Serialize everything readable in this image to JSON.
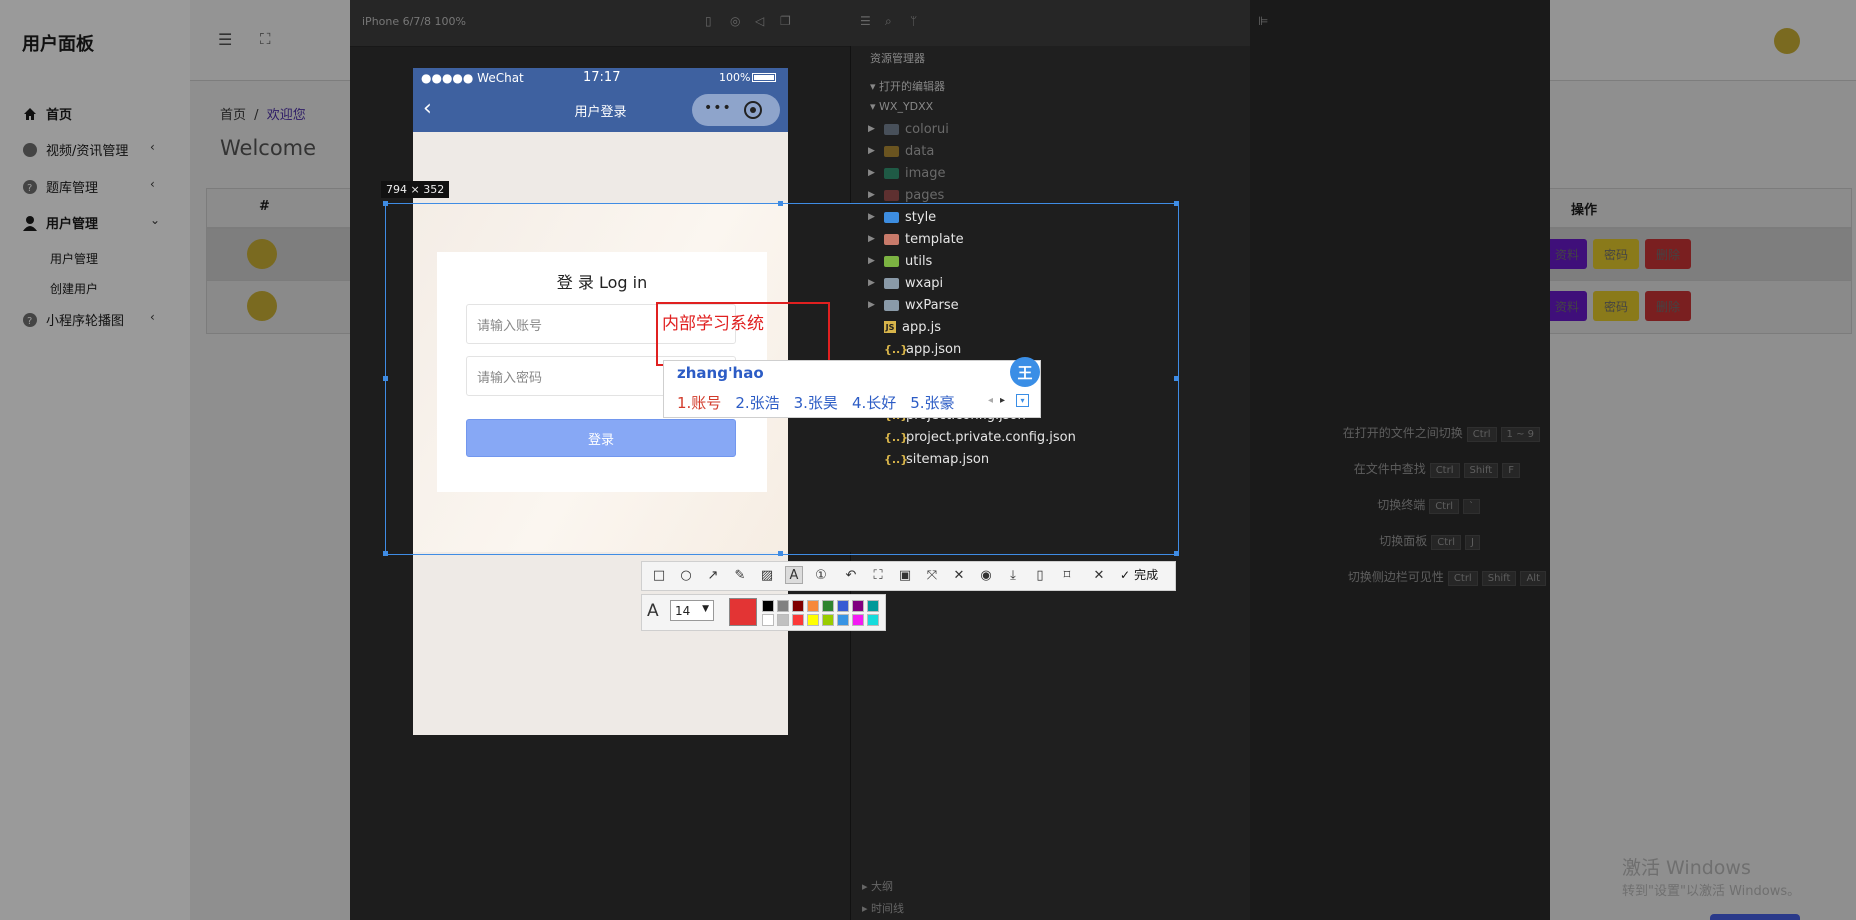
{
  "admin": {
    "title": "用户面板",
    "nav": [
      {
        "label": "首页",
        "icon": "home-icon"
      },
      {
        "label": "视频/资讯管理",
        "icon": "globe-icon"
      },
      {
        "label": "题库管理",
        "icon": "question-icon"
      },
      {
        "label": "用户管理",
        "icon": "user-icon"
      },
      {
        "label": "小程序轮播图",
        "icon": "question-icon"
      }
    ],
    "sub_items": [
      "用户管理",
      "创建用户"
    ],
    "breadcrumb": {
      "home": "首页",
      "separator": "/",
      "current": "欢迎您"
    },
    "welcome": "Welcome",
    "table": {
      "col_index": "#",
      "col_ops": "操作",
      "row_buttons": [
        "资料",
        "密码",
        "删除"
      ]
    }
  },
  "devtools": {
    "device": "iPhone 6/7/8 100%",
    "explorer": {
      "title": "资源管理器",
      "open_editors": "打开的编辑器",
      "project": "WX_YDXX",
      "tree": [
        {
          "name": "colorui",
          "type": "folder",
          "color": "#6f7a86"
        },
        {
          "name": "data",
          "type": "folder",
          "color": "#d4a637"
        },
        {
          "name": "image",
          "type": "folder",
          "color": "#3aa87a"
        },
        {
          "name": "pages",
          "type": "folder",
          "color": "#c45a5a"
        },
        {
          "name": "style",
          "type": "folder",
          "color": "#3d8de0"
        },
        {
          "name": "template",
          "type": "folder",
          "color": "#c87a6a"
        },
        {
          "name": "utils",
          "type": "folder",
          "color": "#7cb342"
        },
        {
          "name": "wxapi",
          "type": "folder",
          "color": "#8a9aa8"
        },
        {
          "name": "wxParse",
          "type": "folder",
          "color": "#8a9aa8"
        },
        {
          "name": "app.js",
          "type": "js"
        },
        {
          "name": "app.json",
          "type": "json"
        },
        {
          "name": "project.config.json",
          "type": "json"
        },
        {
          "name": "project.private.config.json",
          "type": "json"
        },
        {
          "name": "sitemap.json",
          "type": "json"
        }
      ],
      "bottom": [
        "大纲",
        "时间线"
      ]
    },
    "shortcuts": [
      {
        "label": "在打开的文件之间切换",
        "keys": [
          "Ctrl",
          "1 ~ 9"
        ]
      },
      {
        "label": "在文件中查找",
        "keys": [
          "Ctrl",
          "Shift",
          "F"
        ]
      },
      {
        "label": "切换终端",
        "keys": [
          "Ctrl",
          "`"
        ]
      },
      {
        "label": "切换面板",
        "keys": [
          "Ctrl",
          "J"
        ]
      },
      {
        "label": "切换侧边栏可见性",
        "keys": [
          "Ctrl",
          "Shift",
          "Alt"
        ]
      }
    ]
  },
  "phone": {
    "carrier": "●●●●● WeChat",
    "time": "17:17",
    "battery": "100%",
    "nav_title": "用户登录",
    "login": {
      "title": "登 录 Log in",
      "account_placeholder": "请输入账号",
      "password_placeholder": "请输入密码",
      "button": "登录"
    }
  },
  "screenshot": {
    "size_label": "794 × 352",
    "annotation": "内部学习系统",
    "done_label": "完成",
    "font_size": "14",
    "current_color": "#e33434",
    "palette": [
      "#000000",
      "#808080",
      "#800000",
      "#f7883a",
      "#308430",
      "#385ad3",
      "#800080",
      "#009999",
      "#ffffff",
      "#c0c0c0",
      "#fb3838",
      "#ffff00",
      "#99cc00",
      "#3894e4",
      "#f31bf3",
      "#16dcdc"
    ]
  },
  "ime": {
    "input": "zhang'hao",
    "candidates": [
      "1.账号",
      "2.张浩",
      "3.张昊",
      "4.长好",
      "5.张豪"
    ],
    "logo": "王"
  },
  "watermark": {
    "line1": "激活 Windows",
    "line2": "转到\"设置\"以激活 Windows。"
  }
}
